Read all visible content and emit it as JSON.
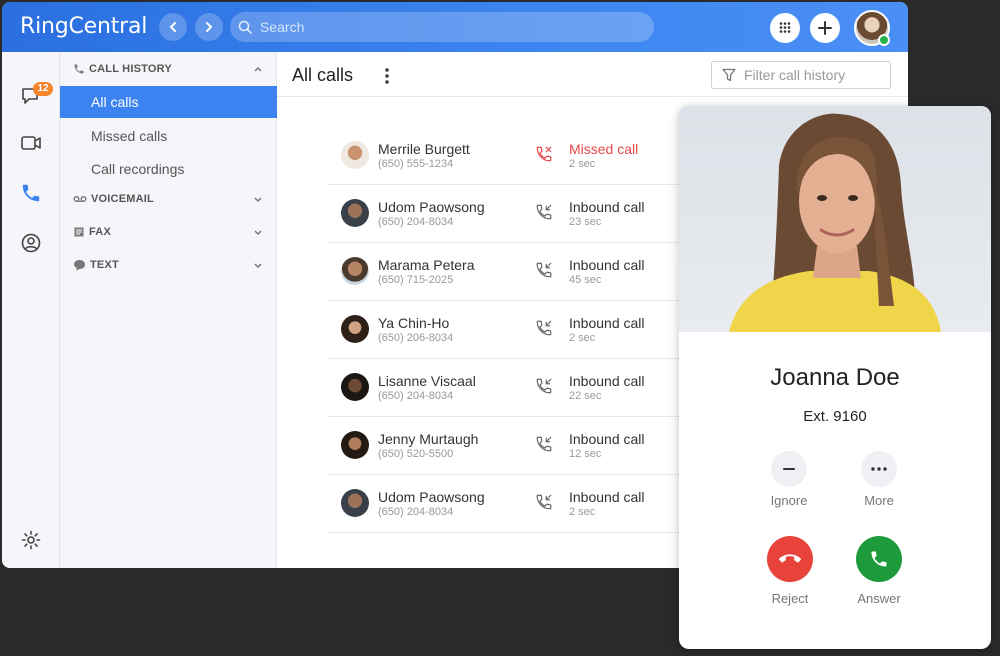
{
  "app": {
    "logo": "RingCentral",
    "search_placeholder": "Search",
    "unread_badge": "12"
  },
  "sidebar": {
    "call_history_label": "CALL HISTORY",
    "items": [
      {
        "label": "All calls"
      },
      {
        "label": "Missed calls"
      },
      {
        "label": "Call recordings"
      }
    ],
    "voicemail_label": "VOICEMAIL",
    "fax_label": "FAX",
    "text_label": "TEXT"
  },
  "main": {
    "title": "All calls",
    "filter_placeholder": "Filter call history",
    "calls": [
      {
        "name": "Merrile Burgett",
        "phone": "(650) 555-1234",
        "type": "Missed call",
        "duration": "2 sec"
      },
      {
        "name": "Udom Paowsong",
        "phone": "(650) 204-8034",
        "type": "Inbound call",
        "duration": "23 sec"
      },
      {
        "name": "Marama Petera",
        "phone": "(650) 715-2025",
        "type": "Inbound call",
        "duration": "45 sec"
      },
      {
        "name": "Ya Chin-Ho",
        "phone": "(650) 206-8034",
        "type": "Inbound call",
        "duration": "2 sec"
      },
      {
        "name": "Lisanne Viscaal",
        "phone": "(650) 204-8034",
        "type": "Inbound call",
        "duration": "22 sec"
      },
      {
        "name": "Jenny Murtaugh",
        "phone": "(650) 520-5500",
        "type": "Inbound call",
        "duration": "12 sec"
      },
      {
        "name": "Udom Paowsong",
        "phone": "(650) 204-8034",
        "type": "Inbound call",
        "duration": "2 sec"
      }
    ]
  },
  "incoming": {
    "name": "Joanna Doe",
    "ext": "Ext. 9160",
    "ignore_label": "Ignore",
    "more_label": "More",
    "reject_label": "Reject",
    "answer_label": "Answer"
  },
  "colors": {
    "brand_blue": "#3c82f0",
    "missed_red": "#e54848",
    "reject_red": "#e8433b",
    "answer_green": "#1f9a3a",
    "badge_orange": "#f5842a"
  }
}
